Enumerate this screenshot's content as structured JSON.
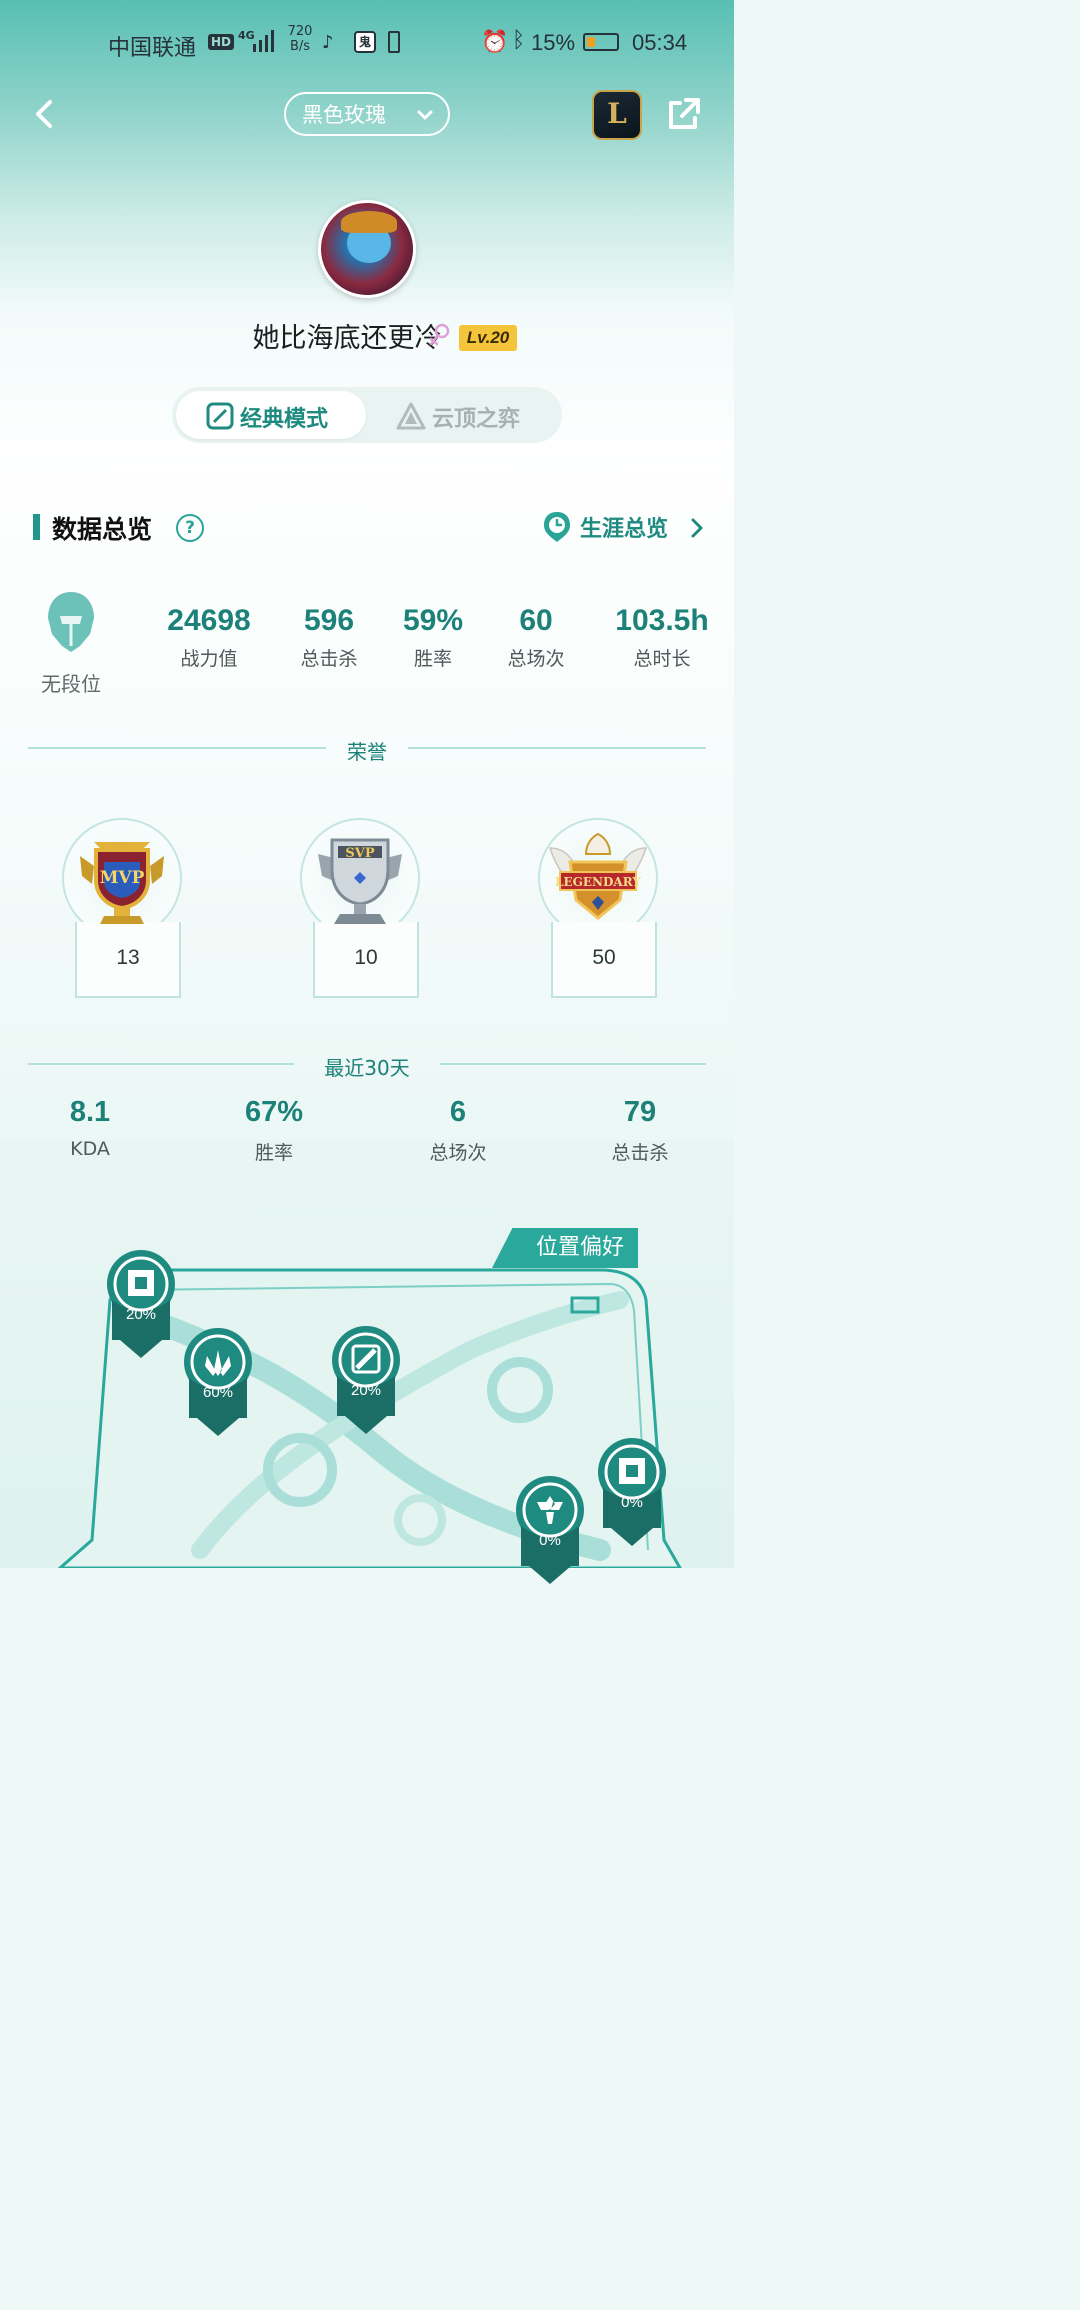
{
  "status_bar": {
    "carrier": "中国联通",
    "hd": "HD",
    "network": "4G",
    "speed": "720 B/s",
    "battery_pct": "15%",
    "time": "05:34"
  },
  "nav": {
    "role": "黑色玫瑰",
    "game_icon": "L"
  },
  "profile": {
    "name": "她比海底还更冷",
    "level": "Lv.20"
  },
  "modes": {
    "classic": "经典模式",
    "tft": "云顶之弈"
  },
  "overview": {
    "title": "数据总览",
    "help": "?",
    "career": "生涯总览",
    "rank": "无段位",
    "stats": [
      {
        "value": "24698",
        "label": "战力值"
      },
      {
        "value": "596",
        "label": "总击杀"
      },
      {
        "value": "59%",
        "label": "胜率"
      },
      {
        "value": "60",
        "label": "总场次"
      },
      {
        "value": "103.5h",
        "label": "总时长"
      }
    ]
  },
  "honors": {
    "title": "荣誉",
    "items": [
      {
        "name": "MVP",
        "count": "13"
      },
      {
        "name": "SVP",
        "count": "10"
      },
      {
        "name": "LEGENDARY",
        "count": "50"
      }
    ]
  },
  "recent": {
    "title": "最近30天",
    "stats": [
      {
        "value": "8.1",
        "label": "KDA"
      },
      {
        "value": "67%",
        "label": "胜率"
      },
      {
        "value": "6",
        "label": "总场次"
      },
      {
        "value": "79",
        "label": "总击杀"
      }
    ]
  },
  "positions": {
    "title": "位置偏好",
    "lanes": [
      {
        "name": "top-lane",
        "pct": "20%"
      },
      {
        "name": "jungle",
        "pct": "60%"
      },
      {
        "name": "mid-lane",
        "pct": "20%"
      },
      {
        "name": "support",
        "pct": "0%"
      },
      {
        "name": "bottom-lane",
        "pct": "0%"
      }
    ]
  },
  "colors": {
    "accent": "#1c8178",
    "teal": "#2aa89b",
    "level_badge": "#f4c43a"
  }
}
